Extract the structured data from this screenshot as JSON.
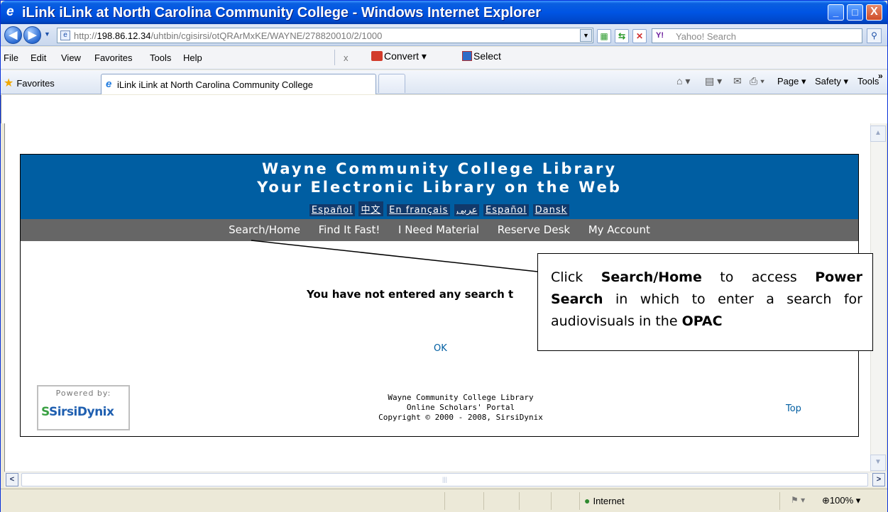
{
  "window": {
    "title": "iLink iLink at North Carolina Community College - Windows Internet Explorer",
    "minimize": "_",
    "maximize": "□",
    "close": "X"
  },
  "navbar": {
    "address_prefix": "http://",
    "address_host": "198.86.12.34",
    "address_path": "/uhtbin/cgisirsi/otQRArMxKE/WAYNE/278820010/2/1000",
    "search_placeholder": "Yahoo! Search",
    "search_brand": "Y!"
  },
  "menubar": {
    "items": [
      "File",
      "Edit",
      "View",
      "Favorites",
      "Tools",
      "Help"
    ],
    "close_x": "x",
    "convert": "Convert",
    "select": "Select"
  },
  "favbar": {
    "favorites": "Favorites",
    "tab_title": "iLink iLink at North Carolina Community College",
    "commands": [
      "Page",
      "Safety",
      "Tools"
    ]
  },
  "page": {
    "banner_line1": "Wayne Community College Library",
    "banner_line2": "Your Electronic Library on the Web",
    "languages": [
      "Español",
      "中文",
      "En français",
      "عربى",
      "Español",
      "Dansk"
    ],
    "nav": [
      "Search/Home",
      "Find It Fast!",
      "I Need Material",
      "Reserve Desk",
      "My Account"
    ],
    "message": "You have not entered any search t",
    "ok": "OK",
    "powered_by": "Powered by:",
    "sirsi_s": "S",
    "sirsi_name": "SirsiDynix",
    "footer": [
      "Wayne Community College Library",
      "Online Scholars' Portal",
      "Copyright © 2000 - 2008, SirsiDynix"
    ],
    "top": "Top"
  },
  "callout": {
    "t1": "Click ",
    "b1": "Search/Home",
    "t2": " to access ",
    "b2": "Power Search",
    "t3": " in which to enter a search for audiovisuals in the ",
    "b3": "OPAC"
  },
  "statusbar": {
    "zone": "Internet",
    "zoom": "100%"
  }
}
